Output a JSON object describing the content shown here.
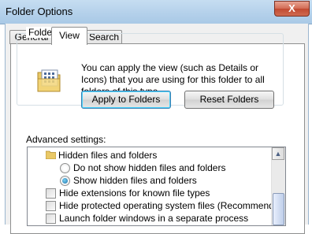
{
  "window": {
    "title": "Folder Options",
    "close_glyph": "X"
  },
  "tabs": [
    {
      "label": "General"
    },
    {
      "label": "View",
      "active": true
    },
    {
      "label": "Search"
    }
  ],
  "folder_views": {
    "label": "Folder views",
    "description": "You can apply the view (such as Details or Icons) that you are using for this folder to all folders of this type.",
    "apply_button": "Apply to Folders",
    "reset_button": "Reset Folders",
    "icon": "folder-views-icon"
  },
  "advanced": {
    "label": "Advanced settings:",
    "items": [
      {
        "type": "folder",
        "label": "Hidden files and folders",
        "icon": "folder-icon"
      },
      {
        "type": "radio",
        "label": "Do not show hidden files and folders",
        "checked": false
      },
      {
        "type": "radio",
        "label": "Show hidden files and folders",
        "checked": true
      },
      {
        "type": "checkbox",
        "label": "Hide extensions for known file types",
        "checked": false
      },
      {
        "type": "checkbox",
        "label": "Hide protected operating system files (Recommended)",
        "checked": false
      },
      {
        "type": "checkbox",
        "label": "Launch folder windows in a separate process",
        "checked": false
      }
    ]
  },
  "colors": {
    "accent": "#3c7fb1",
    "close": "#c14a31"
  }
}
